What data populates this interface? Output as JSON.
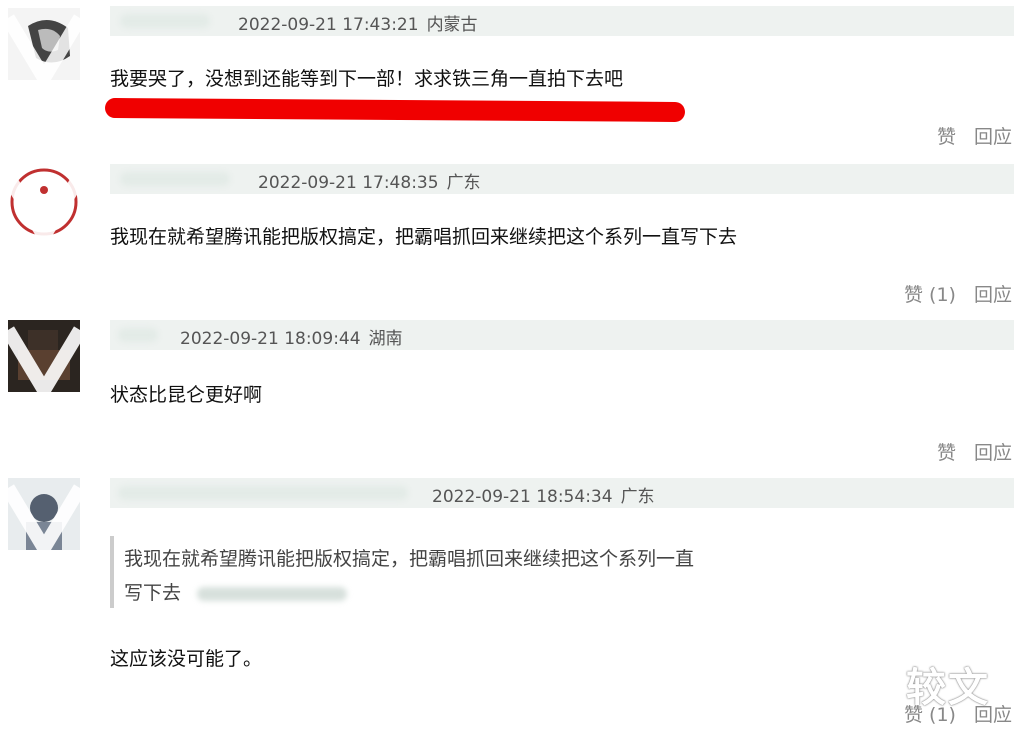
{
  "comments": [
    {
      "timestamp": "2022-09-21 17:43:21",
      "location": "内蒙古",
      "text": "我要哭了，没想到还能等到下一部！求求铁三角一直拍下去吧",
      "like_label": "赞",
      "reply_label": "回应"
    },
    {
      "timestamp": "2022-09-21 17:48:35",
      "location": "广东",
      "text": "我现在就希望腾讯能把版权搞定，把霸唱抓回来继续把这个系列一直写下去",
      "like_label": "赞 (1)",
      "reply_label": "回应"
    },
    {
      "timestamp": "2022-09-21 18:09:44",
      "location": "湖南",
      "text": "状态比昆仑更好啊",
      "like_label": "赞",
      "reply_label": "回应"
    },
    {
      "timestamp": "2022-09-21 18:54:34",
      "location": "广东",
      "quote_line1": "我现在就希望腾讯能把版权搞定，把霸唱抓回来继续把这个系列一直",
      "quote_line2": "写下去",
      "text": "这应该没可能了。",
      "like_label": "赞 (1)",
      "reply_label": "回应"
    }
  ],
  "watermark": "较文",
  "colors": {
    "header_bg": "#eef2f0",
    "highlight": "#f00000",
    "action_text": "#888888"
  }
}
